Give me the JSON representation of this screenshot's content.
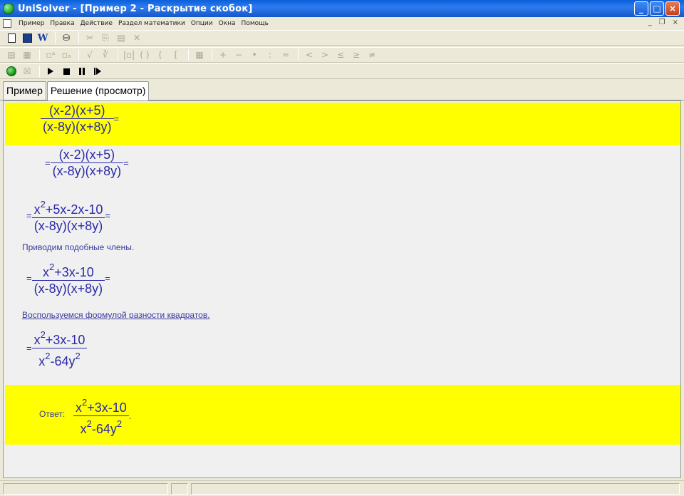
{
  "window": {
    "title": "UniSolver - [Пример 2 - Раскрытие скобок]",
    "buttons": {
      "minimize": "_",
      "maximize": "□",
      "close": "×"
    }
  },
  "menu": {
    "items": [
      "Пример",
      "Правка",
      "Действие",
      "Раздел математики",
      "Опции",
      "Окна",
      "Помощь"
    ],
    "mdi": {
      "minimize": "_",
      "restore": "❐",
      "close": "×"
    }
  },
  "toolbar3_icons": [
    "start-icon",
    "clear-icon",
    "play-icon",
    "stop-icon",
    "pause-icon",
    "step-icon"
  ],
  "tabs": [
    {
      "label": "Пример"
    },
    {
      "label": "Решение (просмотр)"
    }
  ],
  "solution": {
    "problem": {
      "numerator": "(x-2)(x+5)",
      "denominator": "(x-8y)(x+8y)",
      "suffix": "="
    },
    "steps": [
      {
        "prefix": "=",
        "numerator": "(x-2)(x+5)",
        "denominator": "(x-8y)(x+8y)",
        "suffix": "="
      },
      {
        "prefix": "=",
        "numerator_base": "x",
        "numerator_exp": "2",
        "numerator_rest": "+5x-2x-10",
        "denominator": "(x-8y)(x+8y)",
        "suffix": "="
      },
      {
        "note": "Приводим подобные члены."
      },
      {
        "prefix": "=",
        "numerator_base": "x",
        "numerator_exp": "2",
        "numerator_rest": "+3x-10",
        "denominator": "(x-8y)(x+8y)",
        "suffix": "="
      },
      {
        "note": "Воспользуемся формулой разности квадратов."
      },
      {
        "prefix": "=",
        "numerator_base": "x",
        "numerator_exp": "2",
        "numerator_rest": "+3x-10",
        "denominator_base": "x",
        "denominator_exp": "2",
        "denominator_mid": "-64y",
        "denominator_exp2": "2"
      }
    ],
    "answer": {
      "label": "Ответ:",
      "numerator_base": "x",
      "numerator_exp": "2",
      "numerator_rest": "+3x-10",
      "denominator_base": "x",
      "denominator_exp": "2",
      "denominator_mid": "-64y",
      "denominator_exp2": "2",
      "suffix": "."
    }
  },
  "colors": {
    "highlight": "#ffff00",
    "math": "#2a2aa8",
    "titlebar": "#1557c8"
  }
}
